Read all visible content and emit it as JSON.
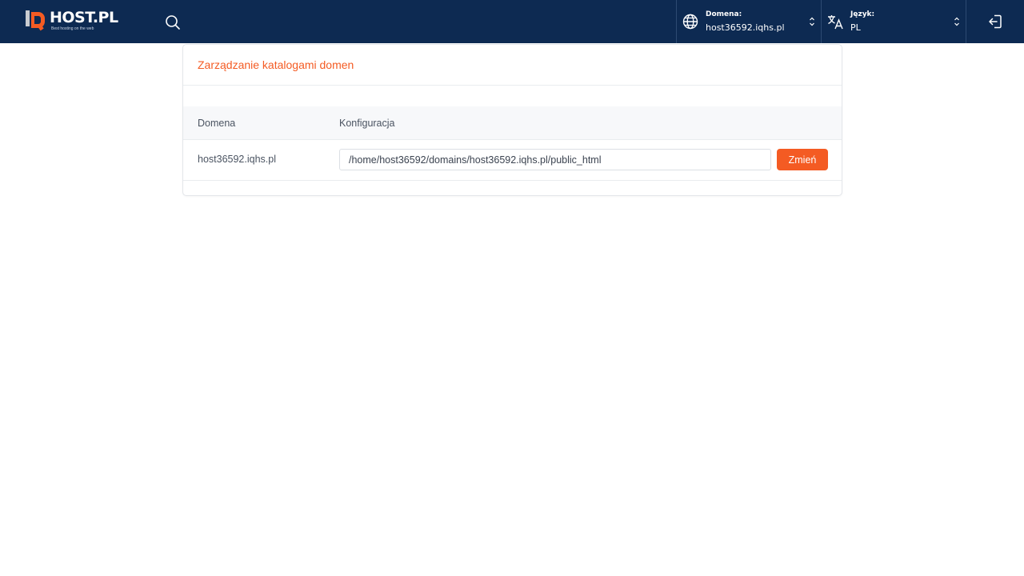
{
  "brand": {
    "name": "HOST.PL",
    "tagline": "Best hosting on the web",
    "primary_color": "#0d2a52",
    "accent_color": "#f45b23"
  },
  "header": {
    "search_icon": "search-icon",
    "domain_selector": {
      "icon": "globe-icon",
      "label": "Domena:",
      "value": "host36592.iqhs.pl"
    },
    "language_selector": {
      "icon": "translate-icon",
      "label": "Język:",
      "value": "PL"
    },
    "logout_icon": "logout-icon"
  },
  "card": {
    "title": "Zarządzanie katalogami domen",
    "table": {
      "columns": [
        "Domena",
        "Konfiguracja"
      ],
      "rows": [
        {
          "domain": "host36592.iqhs.pl",
          "path": "/home/host36592/domains/host36592.iqhs.pl/public_html",
          "button_label": "Zmień"
        }
      ]
    }
  }
}
